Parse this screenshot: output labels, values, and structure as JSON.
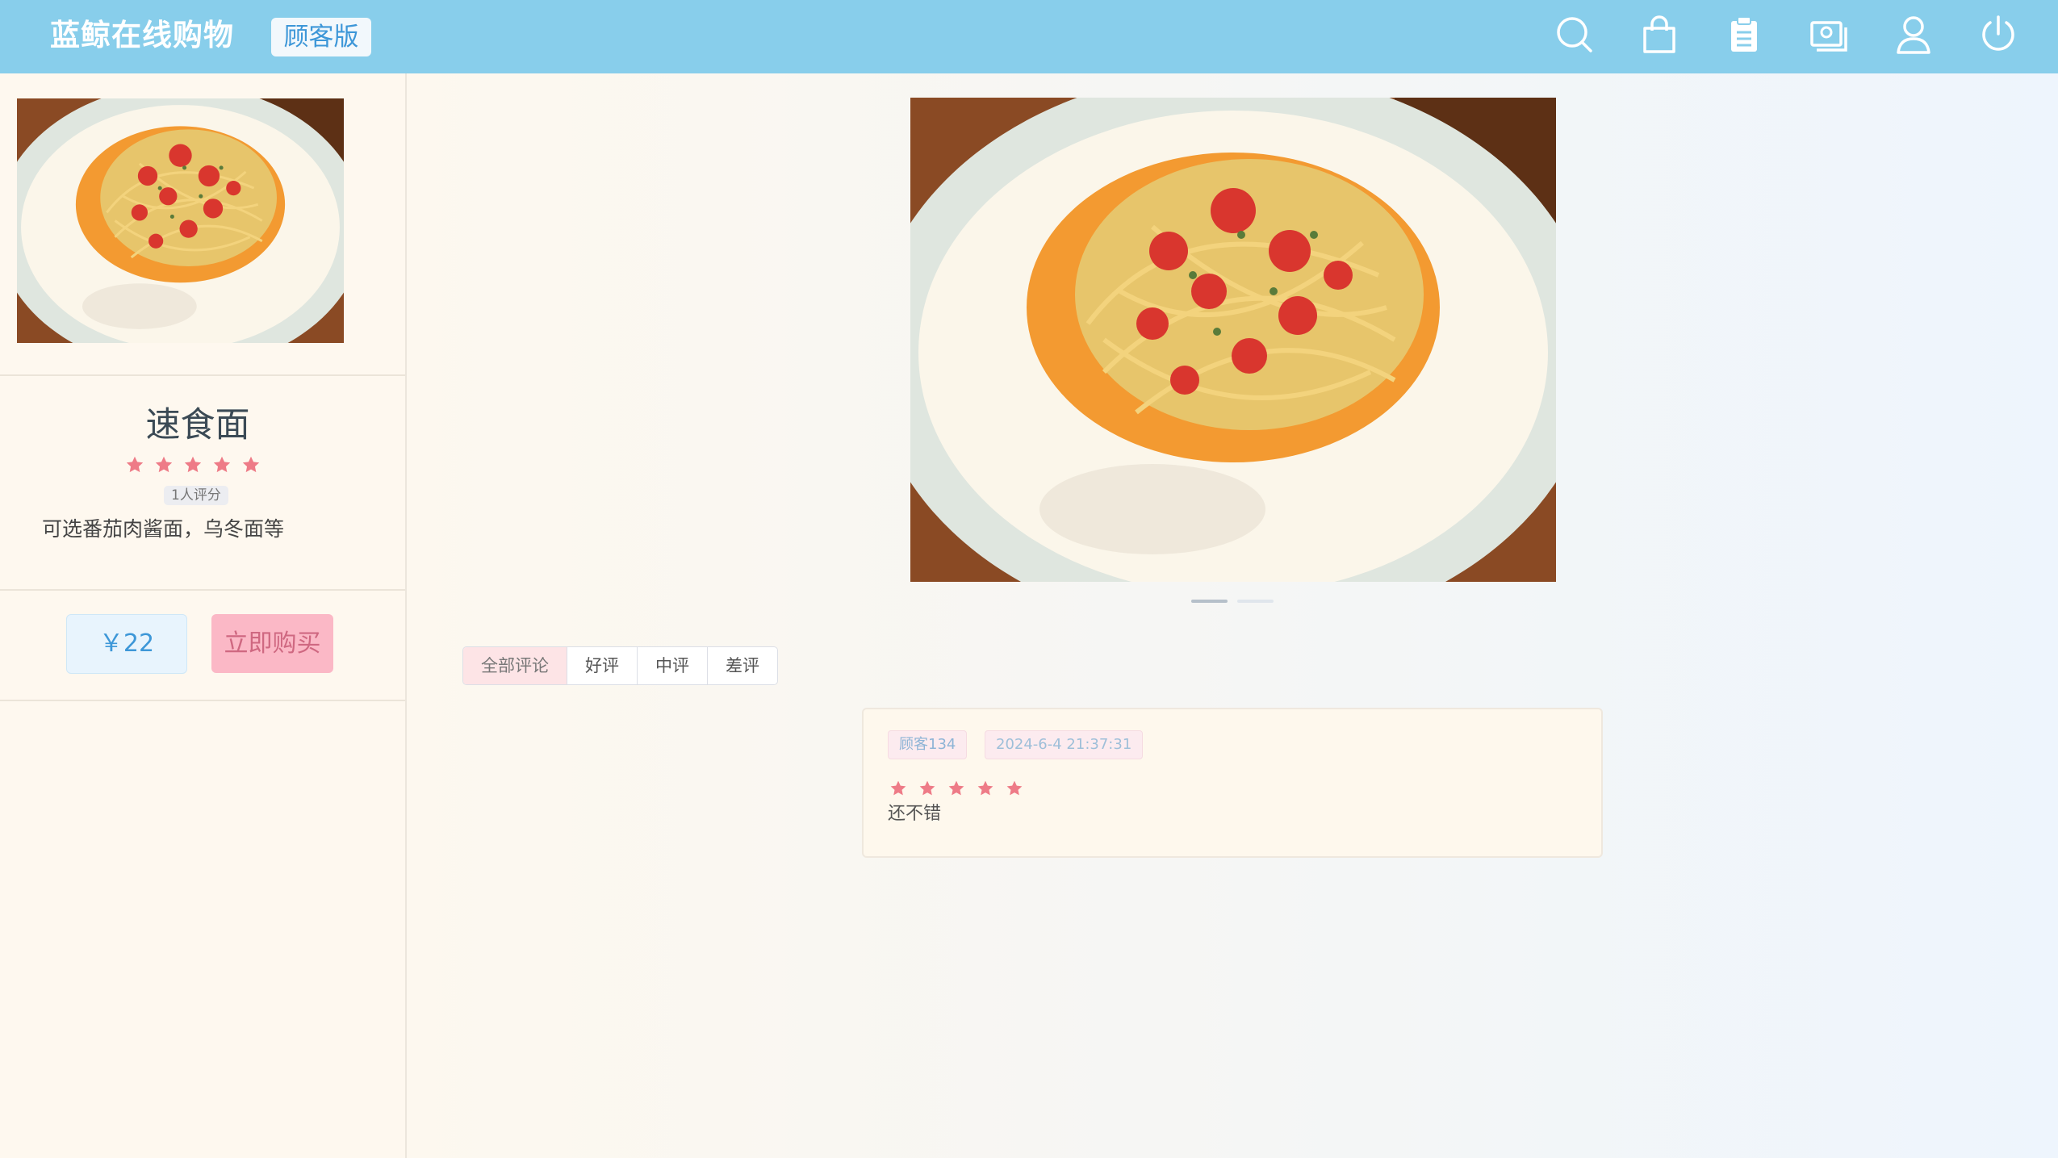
{
  "header": {
    "brand": "蓝鲸在线购物",
    "edition_badge": "顾客版",
    "icons": [
      "search-icon",
      "shopping-bag-icon",
      "clipboard-icon",
      "wallet-icon",
      "user-icon",
      "power-icon"
    ]
  },
  "product": {
    "name": "速食面",
    "rating_stars": 5,
    "rating_count": "1人评分",
    "description": "可选番茄肉酱面，乌冬面等",
    "price": "￥22",
    "buy_label": "立即购买",
    "image": "spaghetti-photo"
  },
  "carousel": {
    "slides": 2,
    "active_index": 0
  },
  "review_tabs": [
    "全部评论",
    "好评",
    "中评",
    "差评"
  ],
  "reviews": [
    {
      "user": "顾客134",
      "time": "2024-6-4 21:37:31",
      "stars": 5,
      "text": "还不错"
    }
  ],
  "colors": {
    "header_bg": "#88ceeb",
    "accent_blue": "#3d97d8",
    "buy_pink": "#fbb8c6",
    "star": "#ee7b87"
  }
}
